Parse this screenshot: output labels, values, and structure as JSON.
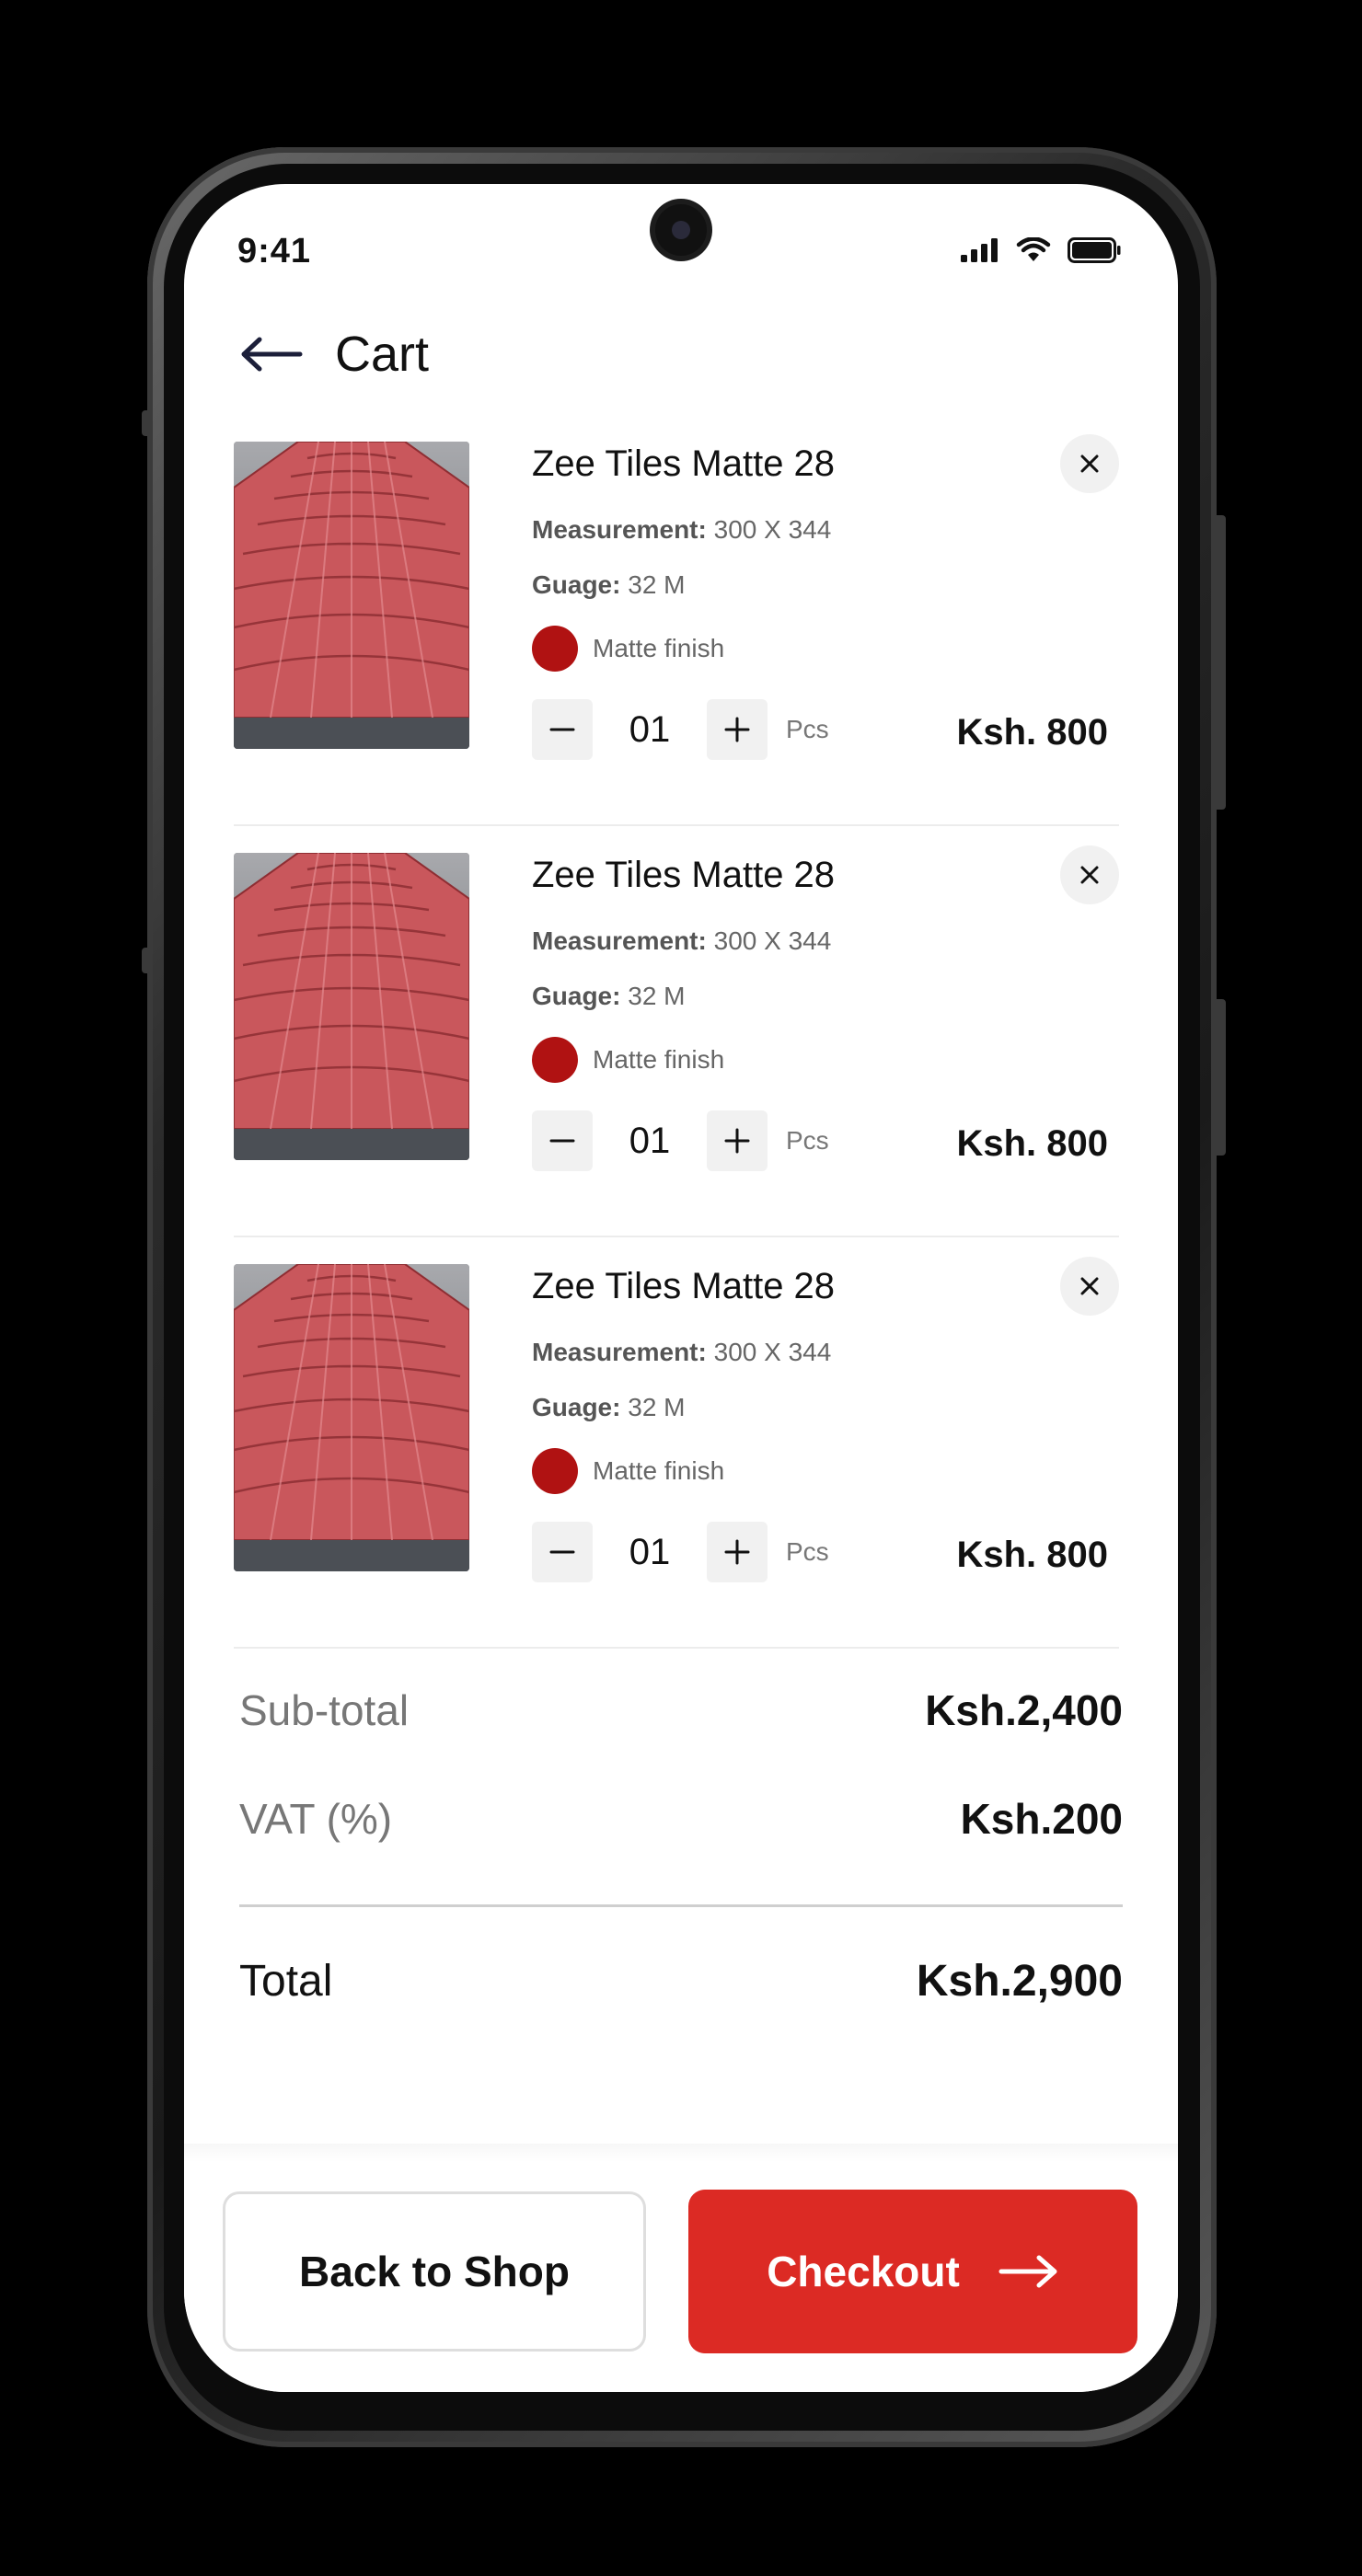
{
  "status_bar": {
    "time": "9:41"
  },
  "header": {
    "title": "Cart"
  },
  "cart_items": [
    {
      "name": "Zee Tiles Matte 28",
      "measurement_label": "Measurement:",
      "measurement_value": "300 X 344",
      "guage_label": "Guage:",
      "guage_value": "32 M",
      "finish": "Matte finish",
      "finish_color": "#b01212",
      "quantity": "01",
      "unit": "Pcs",
      "price": "Ksh. 800"
    },
    {
      "name": "Zee Tiles Matte 28",
      "measurement_label": "Measurement:",
      "measurement_value": "300 X 344",
      "guage_label": "Guage:",
      "guage_value": "32 M",
      "finish": "Matte finish",
      "finish_color": "#b01212",
      "quantity": "01",
      "unit": "Pcs",
      "price": "Ksh. 800"
    },
    {
      "name": "Zee Tiles Matte 28",
      "measurement_label": "Measurement:",
      "measurement_value": "300 X 344",
      "guage_label": "Guage:",
      "guage_value": "32 M",
      "finish": "Matte finish",
      "finish_color": "#b01212",
      "quantity": "01",
      "unit": "Pcs",
      "price": "Ksh. 800"
    }
  ],
  "summary": {
    "subtotal_label": "Sub-total",
    "subtotal_value": "Ksh.2,400",
    "vat_label": "VAT (%)",
    "vat_value": "Ksh.200",
    "total_label": "Total",
    "total_value": "Ksh.2,900"
  },
  "actions": {
    "back_label": "Back to Shop",
    "checkout_label": "Checkout"
  },
  "icons": {
    "back": "arrow-left-icon",
    "remove": "close-icon",
    "minus": "minus-icon",
    "plus": "plus-icon",
    "checkout": "arrow-right-icon"
  },
  "colors": {
    "accent": "#dc2a24",
    "finish": "#b01212"
  }
}
